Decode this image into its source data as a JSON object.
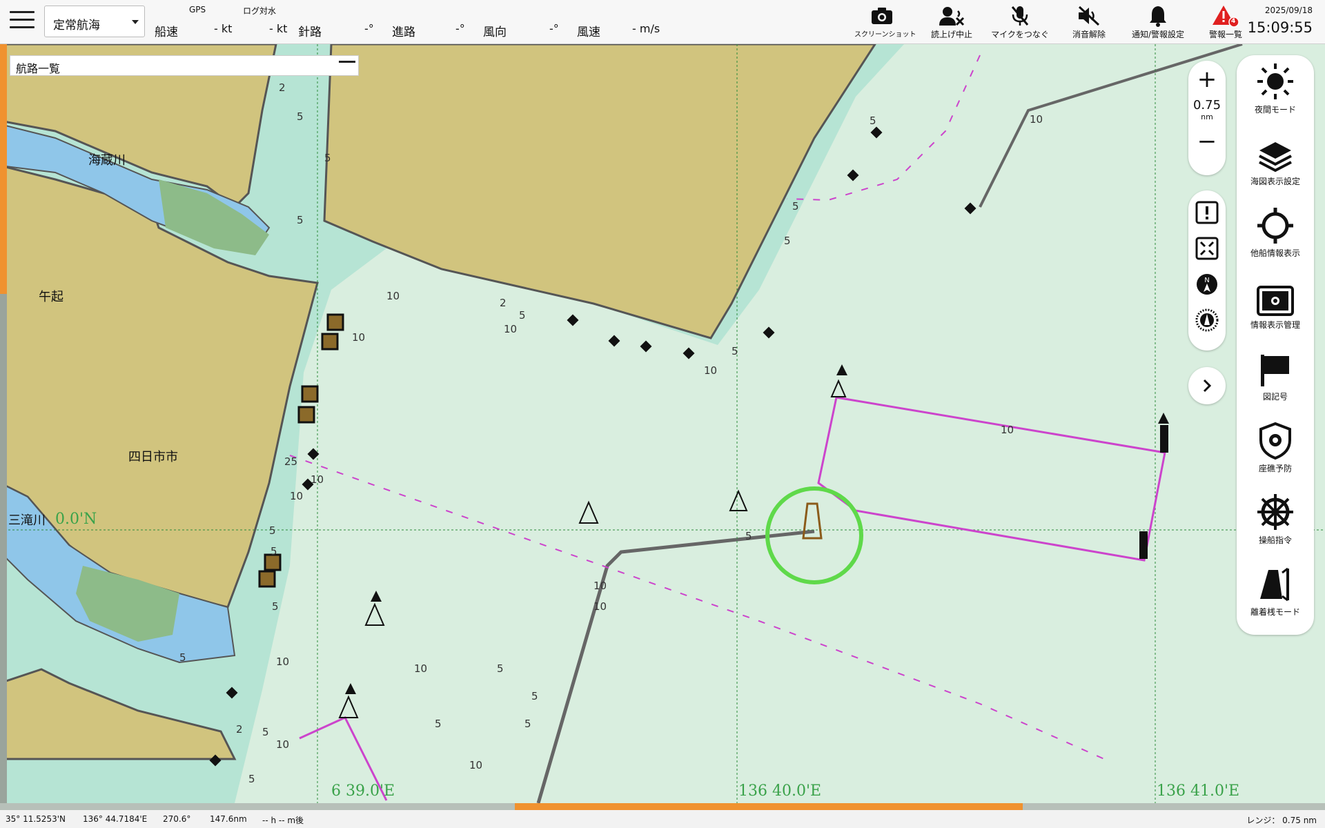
{
  "topbar": {
    "mode": "定常航海",
    "labels": {
      "gps": "GPS",
      "log": "ログ対水",
      "speed": "船速",
      "gps_speed": "- kt",
      "log_speed": "- kt",
      "heading": "針路",
      "heading_val": "-°",
      "course": "進路",
      "course_val": "-°",
      "wind_dir": "風向",
      "wind_dir_val": "-°",
      "wind_speed": "風速",
      "wind_speed_val": "- m/s"
    },
    "buttons": [
      {
        "label": "スクリーンショット",
        "icon": "camera-icon"
      },
      {
        "label": "読上げ中止",
        "icon": "voice-stop-icon"
      },
      {
        "label": "マイクをつなぐ",
        "icon": "mic-off-icon"
      },
      {
        "label": "消音解除",
        "icon": "speaker-mute-icon"
      },
      {
        "label": "通知/警報設定",
        "icon": "bell-icon"
      },
      {
        "label": "警報一覧",
        "icon": "alert-triangle-icon",
        "badge": "4"
      }
    ],
    "date": "2025/09/18",
    "time": "15:09:55"
  },
  "route_panel": {
    "title": "航路一覧"
  },
  "zoom": {
    "value": "0.75",
    "unit": "nm",
    "plus": "+",
    "minus": "−"
  },
  "right_panel": [
    {
      "label": "夜間モード",
      "icon": "sun-icon"
    },
    {
      "label": "海図表示設定",
      "icon": "layers-icon"
    },
    {
      "label": "他船情報表示",
      "icon": "crosshair-icon"
    },
    {
      "label": "情報表示管理",
      "icon": "info-display-icon"
    },
    {
      "label": "図記号",
      "icon": "flag-icon"
    },
    {
      "label": "座礁予防",
      "icon": "shield-gear-icon"
    },
    {
      "label": "操船指令",
      "icon": "ship-wheel-icon"
    },
    {
      "label": "離着桟モード",
      "icon": "berthing-icon"
    }
  ],
  "map_labels": {
    "river1": "海蔵川",
    "town1": "午起",
    "city": "四日市市",
    "river2": "三滝川",
    "lat": "0.0'N",
    "lon1": "6 39.0'E",
    "lon2": "136 40.0'E",
    "lon3": "136 41.0'E"
  },
  "depths": [
    "2",
    "5",
    "5",
    "5",
    "10",
    "10",
    "5",
    "5",
    "2",
    "10",
    "10",
    "5",
    "5",
    "10",
    "5",
    "25",
    "10",
    "10",
    "5",
    "5",
    "5",
    "10",
    "10",
    "5",
    "5",
    "5",
    "10",
    "10",
    "10",
    "5",
    "5",
    "10",
    "5",
    "2",
    "5",
    "5",
    "10"
  ],
  "statusbar": {
    "lat": "35°  11.5253'N",
    "lon": "136°  44.7184'E",
    "bearing": "270.6°",
    "distance": "147.6nm",
    "eta": "-- h -- m後",
    "range": "レンジ：  0.75 nm"
  },
  "colors": {
    "land": "#d1c47e",
    "water_deep": "#d8eedd",
    "water_shallow": "#b6e4d4",
    "river": "#8fc6e9",
    "park": "#8dbb89",
    "route": "#cc44cc",
    "own_ship_ring": "#5fd94a",
    "accent": "#f0922f",
    "alert": "#e02020"
  }
}
